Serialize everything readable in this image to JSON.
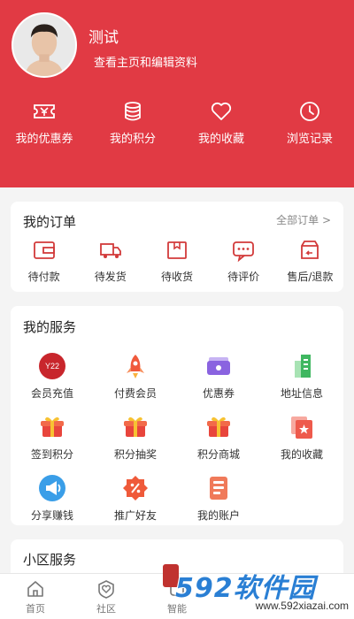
{
  "profile": {
    "name": "测试",
    "edit_link": "查看主页和编辑资料"
  },
  "quick_links": [
    {
      "label": "我的优惠券",
      "icon": "coupon-icon"
    },
    {
      "label": "我的积分",
      "icon": "coins-icon"
    },
    {
      "label": "我的收藏",
      "icon": "heart-icon"
    },
    {
      "label": "浏览记录",
      "icon": "clock-icon"
    }
  ],
  "orders": {
    "title": "我的订单",
    "all_label": "全部订单 >",
    "items": [
      {
        "label": "待付款",
        "icon": "wallet-icon"
      },
      {
        "label": "待发货",
        "icon": "truck-icon"
      },
      {
        "label": "待收货",
        "icon": "package-icon"
      },
      {
        "label": "待评价",
        "icon": "comment-icon"
      },
      {
        "label": "售后/退款",
        "icon": "refund-icon"
      }
    ]
  },
  "services": {
    "title": "我的服务",
    "items": [
      {
        "label": "会员充值",
        "icon": "recharge-icon"
      },
      {
        "label": "付费会员",
        "icon": "rocket-icon"
      },
      {
        "label": "优惠券",
        "icon": "ticket-icon"
      },
      {
        "label": "地址信息",
        "icon": "building-icon"
      },
      {
        "label": "签到积分",
        "icon": "gift-box-icon"
      },
      {
        "label": "积分抽奖",
        "icon": "gift-box-icon"
      },
      {
        "label": "积分商城",
        "icon": "gift-box-icon"
      },
      {
        "label": "我的收藏",
        "icon": "star-folder-icon"
      },
      {
        "label": "分享赚钱",
        "icon": "megaphone-icon"
      },
      {
        "label": "推广好友",
        "icon": "percent-badge-icon"
      },
      {
        "label": "我的账户",
        "icon": "account-doc-icon"
      }
    ]
  },
  "community": {
    "title": "小区服务"
  },
  "tabbar": [
    {
      "label": "首页",
      "icon": "home-icon"
    },
    {
      "label": "社区",
      "icon": "community-icon"
    },
    {
      "label": "智能",
      "icon": "smart-icon"
    }
  ],
  "watermark": {
    "logo": "592软件园",
    "url": "www.592xiazai.com"
  },
  "colors": {
    "brand_red": "#e13a44",
    "background": "#f4f4f4"
  }
}
